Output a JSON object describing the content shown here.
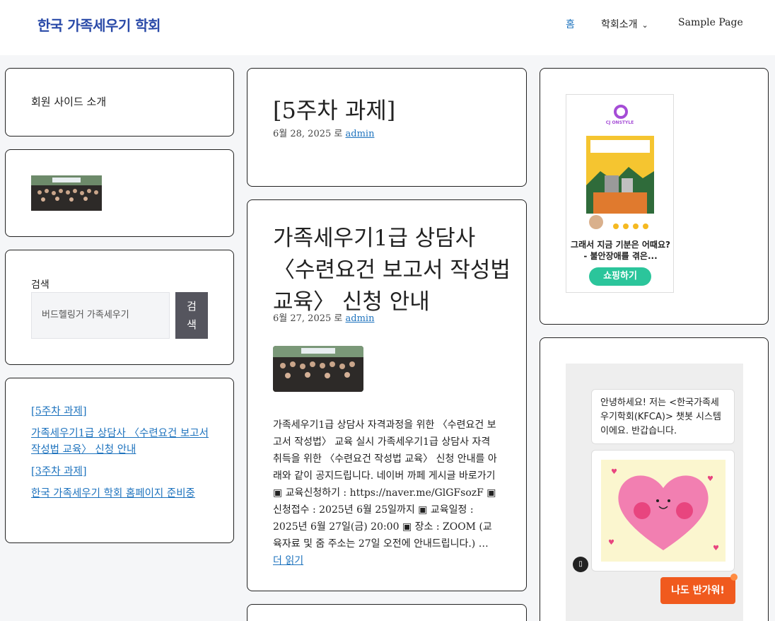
{
  "site": {
    "title": "한국 가족세우기 학회"
  },
  "nav": {
    "home": "홈",
    "about": "학회소개",
    "sample": "Sample Page"
  },
  "left": {
    "intro": "회원 사이드 소개",
    "search_label": "검색",
    "search_value": "버드헬링거 가족세우기",
    "search_button": "검색",
    "recent_posts": [
      "[5주차 과제]",
      "가족세우기1급 상담사 〈수련요건 보고서 작성법 교육〉 신청 안내",
      "[3주차 과제]",
      "한국 가족세우기 학회 홈페이지 준비중"
    ]
  },
  "posts": [
    {
      "title": "[5주차 과제]",
      "date": "6월 28, 2025",
      "by": "로",
      "author": "admin"
    },
    {
      "title": "가족세우기1급 상담사 〈수련요건 보고서 작성법 교육〉 신청 안내",
      "date": "6월 27, 2025",
      "by": "로",
      "author": "admin",
      "excerpt": "가족세우기1급 상담사 자격과정을 위한 〈수련요건 보고서 작성법〉 교육 실시 가족세우기1급 상담사 자격 취득을 위한 〈수련요건 작성법 교육〉 신청 안내를 아래와 같이 공지드립니다. 네이버 까페 게시글 바로가기 ▣ 교육신청하기 : https://naver.me/GlGFsozF ▣ 신청접수 : 2025년 6월 25일까지 ▣ 교육일정 : 2025년 6월 27일(금) 20:00 ▣ 장소 : ZOOM (교육자료 및 줌 주소는 27일 오전에 안내드립니다.) …",
      "read_more": "더 읽기"
    }
  ],
  "ad": {
    "brand": "CJ ONSTYLE",
    "caption": "그래서 지금 기분은 어때요? - 불안장애를 겪은...",
    "button": "쇼핑하기"
  },
  "chat": {
    "greeting": "안녕하세요! 저는 <한국가족세우기학회(KFCA)> 챗봇 시스템이에요. 반갑습니다.",
    "reply": "나도 반가워!"
  },
  "colors": {
    "accent": "#1e73be",
    "title": "#2a4aa8",
    "shop": "#2bc59b",
    "reply": "#f05a1e"
  }
}
